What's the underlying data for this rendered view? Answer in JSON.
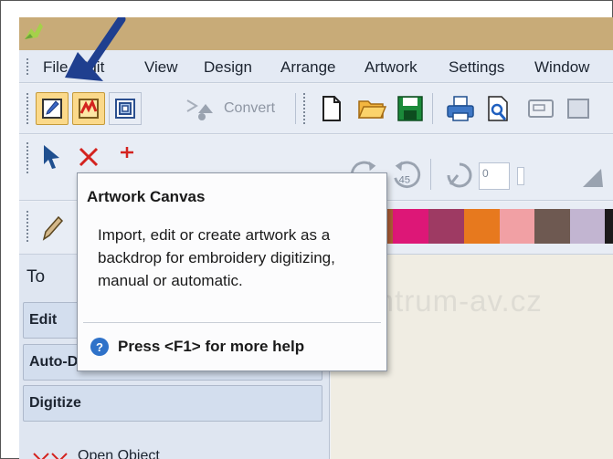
{
  "menu": {
    "items": [
      "File",
      "Edit",
      "View",
      "Design",
      "Arrange",
      "Artwork",
      "Settings",
      "Window"
    ]
  },
  "toolbar": {
    "convert_label": "Convert",
    "rotate_left_value": "45",
    "rotate_right_value": "45",
    "angle_value": "0"
  },
  "colors": {
    "swatches": [
      "#b05e36",
      "#dd1777",
      "#9e3a63",
      "#e7791e",
      "#f1a0a4",
      "#6e5951",
      "#c2b5d1",
      "#1c1a1b"
    ]
  },
  "panel": {
    "title": "To",
    "sections": [
      "Edit",
      "Auto-Digitize",
      "Digitize"
    ],
    "open_object_label": "Open Object"
  },
  "watermark": "www.berninacentrum-av.cz",
  "tooltip": {
    "title": "Artwork Canvas",
    "body": "Import, edit or create artwork as a backdrop for embroidery digitizing, manual or automatic.",
    "help": "Press <F1> for more help"
  }
}
